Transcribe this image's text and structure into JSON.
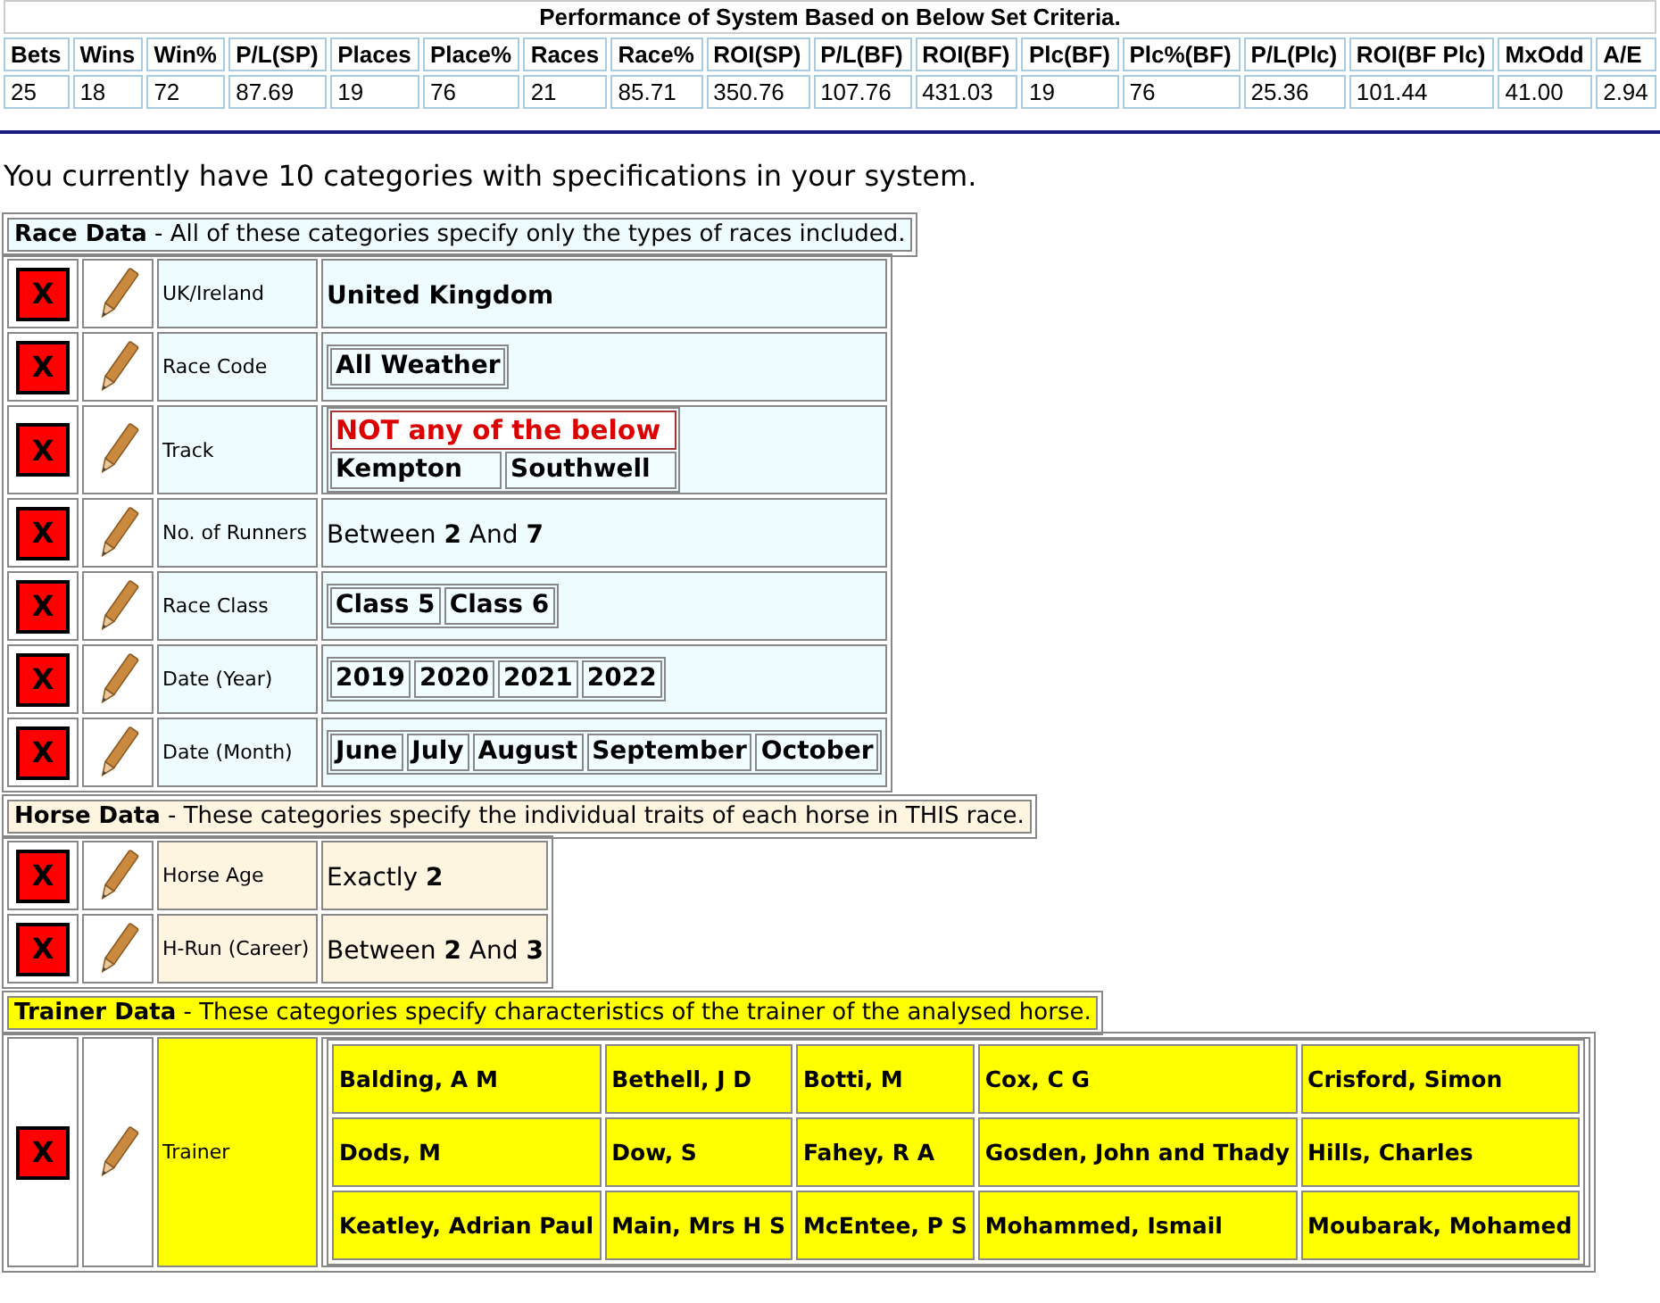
{
  "performance": {
    "title": "Performance of System Based on Below Set Criteria.",
    "columns": [
      "Bets",
      "Wins",
      "Win%",
      "P/L(SP)",
      "Places",
      "Place%",
      "Races",
      "Race%",
      "ROI(SP)",
      "P/L(BF)",
      "ROI(BF)",
      "Plc(BF)",
      "Plc%(BF)",
      "P/L(Plc)",
      "ROI(BF Plc)",
      "MxOdd",
      "A/E"
    ],
    "values": [
      "25",
      "18",
      "72",
      "87.69",
      "19",
      "76",
      "21",
      "85.71",
      "350.76",
      "107.76",
      "431.03",
      "19",
      "76",
      "25.36",
      "101.44",
      "41.00",
      "2.94"
    ]
  },
  "summary": "You currently have 10 categories with specifications in your system.",
  "sections": [
    {
      "title": "Race Data",
      "description": " - All of these categories specify only the types of races included.",
      "color": "#eefcff",
      "categories": [
        {
          "delete": "X",
          "label": "UK/Ireland",
          "kind": "bold",
          "text": "United Kingdom"
        },
        {
          "delete": "X",
          "label": "Race Code",
          "kind": "tags",
          "tags": [
            "All Weather"
          ]
        },
        {
          "delete": "X",
          "label": "Track",
          "kind": "excluded_tags",
          "note": "NOT any of the below",
          "tags": [
            "Kempton",
            "Southwell"
          ]
        },
        {
          "delete": "X",
          "label": "No. of Runners",
          "kind": "rich",
          "text": "Between **2** And **7**"
        },
        {
          "delete": "X",
          "label": "Race Class",
          "kind": "tags",
          "tags": [
            "Class 5",
            "Class 6"
          ]
        },
        {
          "delete": "X",
          "label": "Date (Year)",
          "kind": "tags",
          "tags": [
            "2019",
            "2020",
            "2021",
            "2022"
          ]
        },
        {
          "delete": "X",
          "label": "Date (Month)",
          "kind": "tags",
          "tags": [
            "June",
            "July",
            "August",
            "September",
            "October"
          ]
        }
      ]
    },
    {
      "title": "Horse Data",
      "description": " - These categories specify the individual traits of each horse in THIS race.",
      "color": "#fdf5e0",
      "categories": [
        {
          "delete": "X",
          "label": "Horse Age",
          "kind": "rich",
          "text": "Exactly **2**"
        },
        {
          "delete": "X",
          "label": "H-Run (Career)",
          "kind": "rich",
          "text": "Between **2** And **3**"
        }
      ]
    },
    {
      "title": "Trainer Data",
      "description": " - These categories specify characteristics of the trainer of the analysed horse.",
      "color": "#ffff00",
      "categories": [
        {
          "delete": "X",
          "label": "Trainer",
          "kind": "grid",
          "rows": [
            [
              "Balding, A M",
              "Bethell, J D",
              "Botti, M",
              "Cox, C G",
              "Crisford, Simon"
            ],
            [
              "Dods, M",
              "Dow, S",
              "Fahey, R A",
              "Gosden, John and Thady",
              "Hills, Charles"
            ],
            [
              "Keatley, Adrian Paul",
              "Main, Mrs H S",
              "McEntee, P S",
              "Mohammed, Ismail",
              "Moubarak, Mohamed"
            ]
          ]
        }
      ]
    }
  ]
}
